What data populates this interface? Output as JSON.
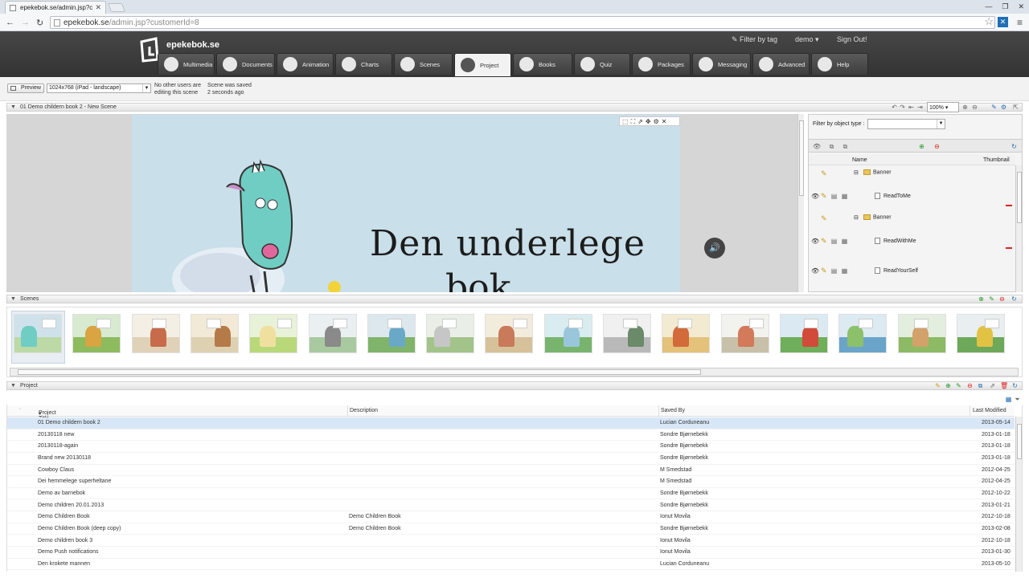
{
  "browser": {
    "tab_title": "epekebok.se/admin.jsp?c",
    "url_host": "epekebok.se",
    "url_path": "/admin.jsp?customerId=8"
  },
  "app": {
    "brand": "epekebok.se",
    "filter_by_tag": "Filter by tag",
    "user": "demo ▾",
    "sign_out": "Sign Out!",
    "nav": [
      {
        "label": "Multimedia",
        "icon": "multimedia-icon"
      },
      {
        "label": "Documents",
        "icon": "documents-icon"
      },
      {
        "label": "Animation",
        "icon": "animation-icon"
      },
      {
        "label": "Charts",
        "icon": "charts-icon"
      },
      {
        "label": "Scenes",
        "icon": "scenes-icon"
      },
      {
        "label": "Project",
        "icon": "project-icon"
      },
      {
        "label": "Books",
        "icon": "books-icon"
      },
      {
        "label": "Quiz",
        "icon": "quiz-icon"
      },
      {
        "label": "Packages",
        "icon": "packages-icon"
      },
      {
        "label": "Messaging",
        "icon": "messaging-icon"
      },
      {
        "label": "Advanced",
        "icon": "advanced-icon"
      },
      {
        "label": "Help",
        "icon": "help-icon"
      }
    ]
  },
  "toolbar": {
    "preview": "Preview",
    "device": "1024x768 (iPad - landscape)",
    "users_msg_1": "No other users are",
    "users_msg_2": "editing this scene",
    "saved_msg_1": "Scene was saved",
    "saved_msg_2": "2 seconds ago"
  },
  "editor": {
    "header": "01 Demo childern book 2 - New Scene",
    "zoom": "100%",
    "stage_title_1": "Den underlege",
    "stage_title_2": "bok"
  },
  "objects": {
    "filter_label": "Filter by object type :",
    "col_name": "Name",
    "col_thumbnail": "Thumbnail",
    "rows": [
      {
        "type": "folder",
        "name": "Banner"
      },
      {
        "type": "item",
        "name": "ReadToMe"
      },
      {
        "type": "folder",
        "name": "Banner"
      },
      {
        "type": "item",
        "name": "ReadWithMe"
      },
      {
        "type": "item",
        "name": "ReadYourSelf"
      }
    ]
  },
  "scenes": {
    "header": "Scenes",
    "count": 17
  },
  "project": {
    "header": "Project",
    "columns": [
      "Project Title",
      "Description",
      "Saved By",
      "Last Modified"
    ],
    "rows": [
      {
        "title": "01 Demo childern book 2",
        "description": "",
        "saved_by": "Lucian Corduneanu",
        "modified": "2013-05-14"
      },
      {
        "title": "20130118 new",
        "description": "",
        "saved_by": "Sondre Bjørnebekk",
        "modified": "2013-01-18"
      },
      {
        "title": "20130118-again",
        "description": "",
        "saved_by": "Sondre Bjørnebekk",
        "modified": "2013-01-18"
      },
      {
        "title": "Brand new 20130118",
        "description": "",
        "saved_by": "Sondre Bjørnebekk",
        "modified": "2013-01-18"
      },
      {
        "title": "Cowboy Claus",
        "description": "",
        "saved_by": "M Smedstad",
        "modified": "2012-04-25"
      },
      {
        "title": "Dei hemmelege superheltane",
        "description": "",
        "saved_by": "M Smedstad",
        "modified": "2012-04-25"
      },
      {
        "title": "Demo av barnebok",
        "description": "",
        "saved_by": "Sondre Bjørnebekk",
        "modified": "2012-10-22"
      },
      {
        "title": "Demo children 20.01.2013",
        "description": "",
        "saved_by": "Sondre Bjørnebekk",
        "modified": "2013-01-21"
      },
      {
        "title": "Demo Children Book",
        "description": "Demo Children Book",
        "saved_by": "Ionut Movila",
        "modified": "2012-10-18"
      },
      {
        "title": "Demo Children Book (deep copy)",
        "description": "Demo Children Book",
        "saved_by": "Sondre Bjørnebekk",
        "modified": "2013-02-08"
      },
      {
        "title": "Demo children book 3",
        "description": "",
        "saved_by": "Ionut Movila",
        "modified": "2012-10-18"
      },
      {
        "title": "Demo Push notifications",
        "description": "",
        "saved_by": "Ionut Movila",
        "modified": "2013-01-30"
      },
      {
        "title": "Den krokete mannen",
        "description": "",
        "saved_by": "Lucian Corduneanu",
        "modified": "2013-05-10"
      }
    ]
  }
}
